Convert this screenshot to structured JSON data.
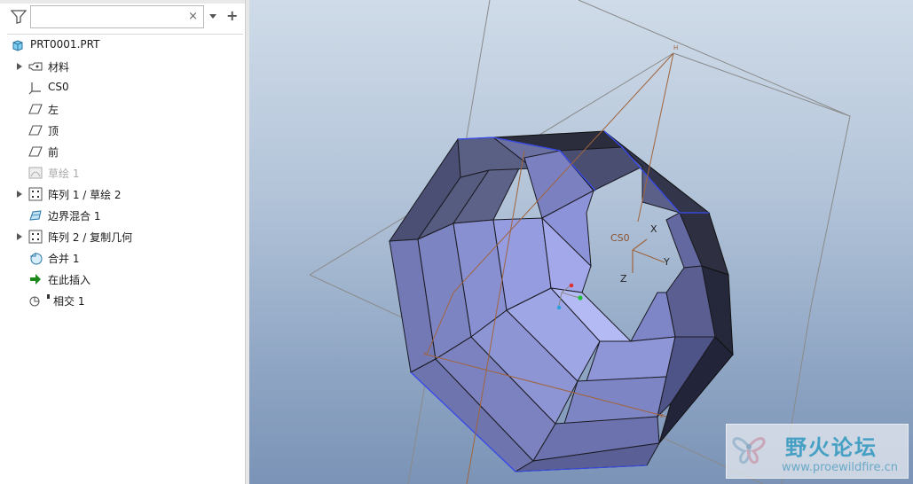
{
  "search": {
    "value": "",
    "placeholder": "",
    "clear_symbol": "×"
  },
  "toolbar": {
    "add_symbol": "+"
  },
  "tree": {
    "root": {
      "label": "PRT0001.PRT",
      "icon": "part-cube-icon"
    },
    "items": [
      {
        "label": "材料",
        "icon": "material-icon",
        "expandable": true,
        "disabled": false
      },
      {
        "label": "CS0",
        "icon": "coordinate-system-icon",
        "expandable": false,
        "disabled": false
      },
      {
        "label": "左",
        "icon": "datum-plane-icon",
        "expandable": false,
        "disabled": false
      },
      {
        "label": "顶",
        "icon": "datum-plane-icon",
        "expandable": false,
        "disabled": false
      },
      {
        "label": "前",
        "icon": "datum-plane-icon",
        "expandable": false,
        "disabled": false
      },
      {
        "label": "草绘 1",
        "icon": "sketch-icon",
        "expandable": false,
        "disabled": true
      },
      {
        "label": "阵列 1 / 草绘 2",
        "icon": "pattern-icon",
        "expandable": true,
        "disabled": false
      },
      {
        "label": "边界混合 1",
        "icon": "boundary-blend-icon",
        "expandable": false,
        "disabled": false
      },
      {
        "label": "阵列 2 / 复制几何",
        "icon": "pattern-icon",
        "expandable": true,
        "disabled": false
      },
      {
        "label": "合并 1",
        "icon": "merge-icon",
        "expandable": false,
        "disabled": false
      },
      {
        "label": "在此插入",
        "icon": "insert-here-arrow-icon",
        "expandable": false,
        "disabled": false
      },
      {
        "label": "相交 1",
        "icon": "intersect-icon",
        "expandable": false,
        "disabled": false
      }
    ]
  },
  "viewport": {
    "labels": {
      "csys": "CS0",
      "x": "X",
      "y": "Y",
      "z": "Z"
    }
  },
  "watermark": {
    "title": "野火论坛",
    "url": "www.proewildfire.cn"
  },
  "colors": {
    "accent_green": "#1e8a1e",
    "surface_light": "#a9b1ec",
    "surface_dark": "#3b3f5c",
    "edge_blue": "#3a4cf0",
    "datum_brown": "#a0643c"
  }
}
